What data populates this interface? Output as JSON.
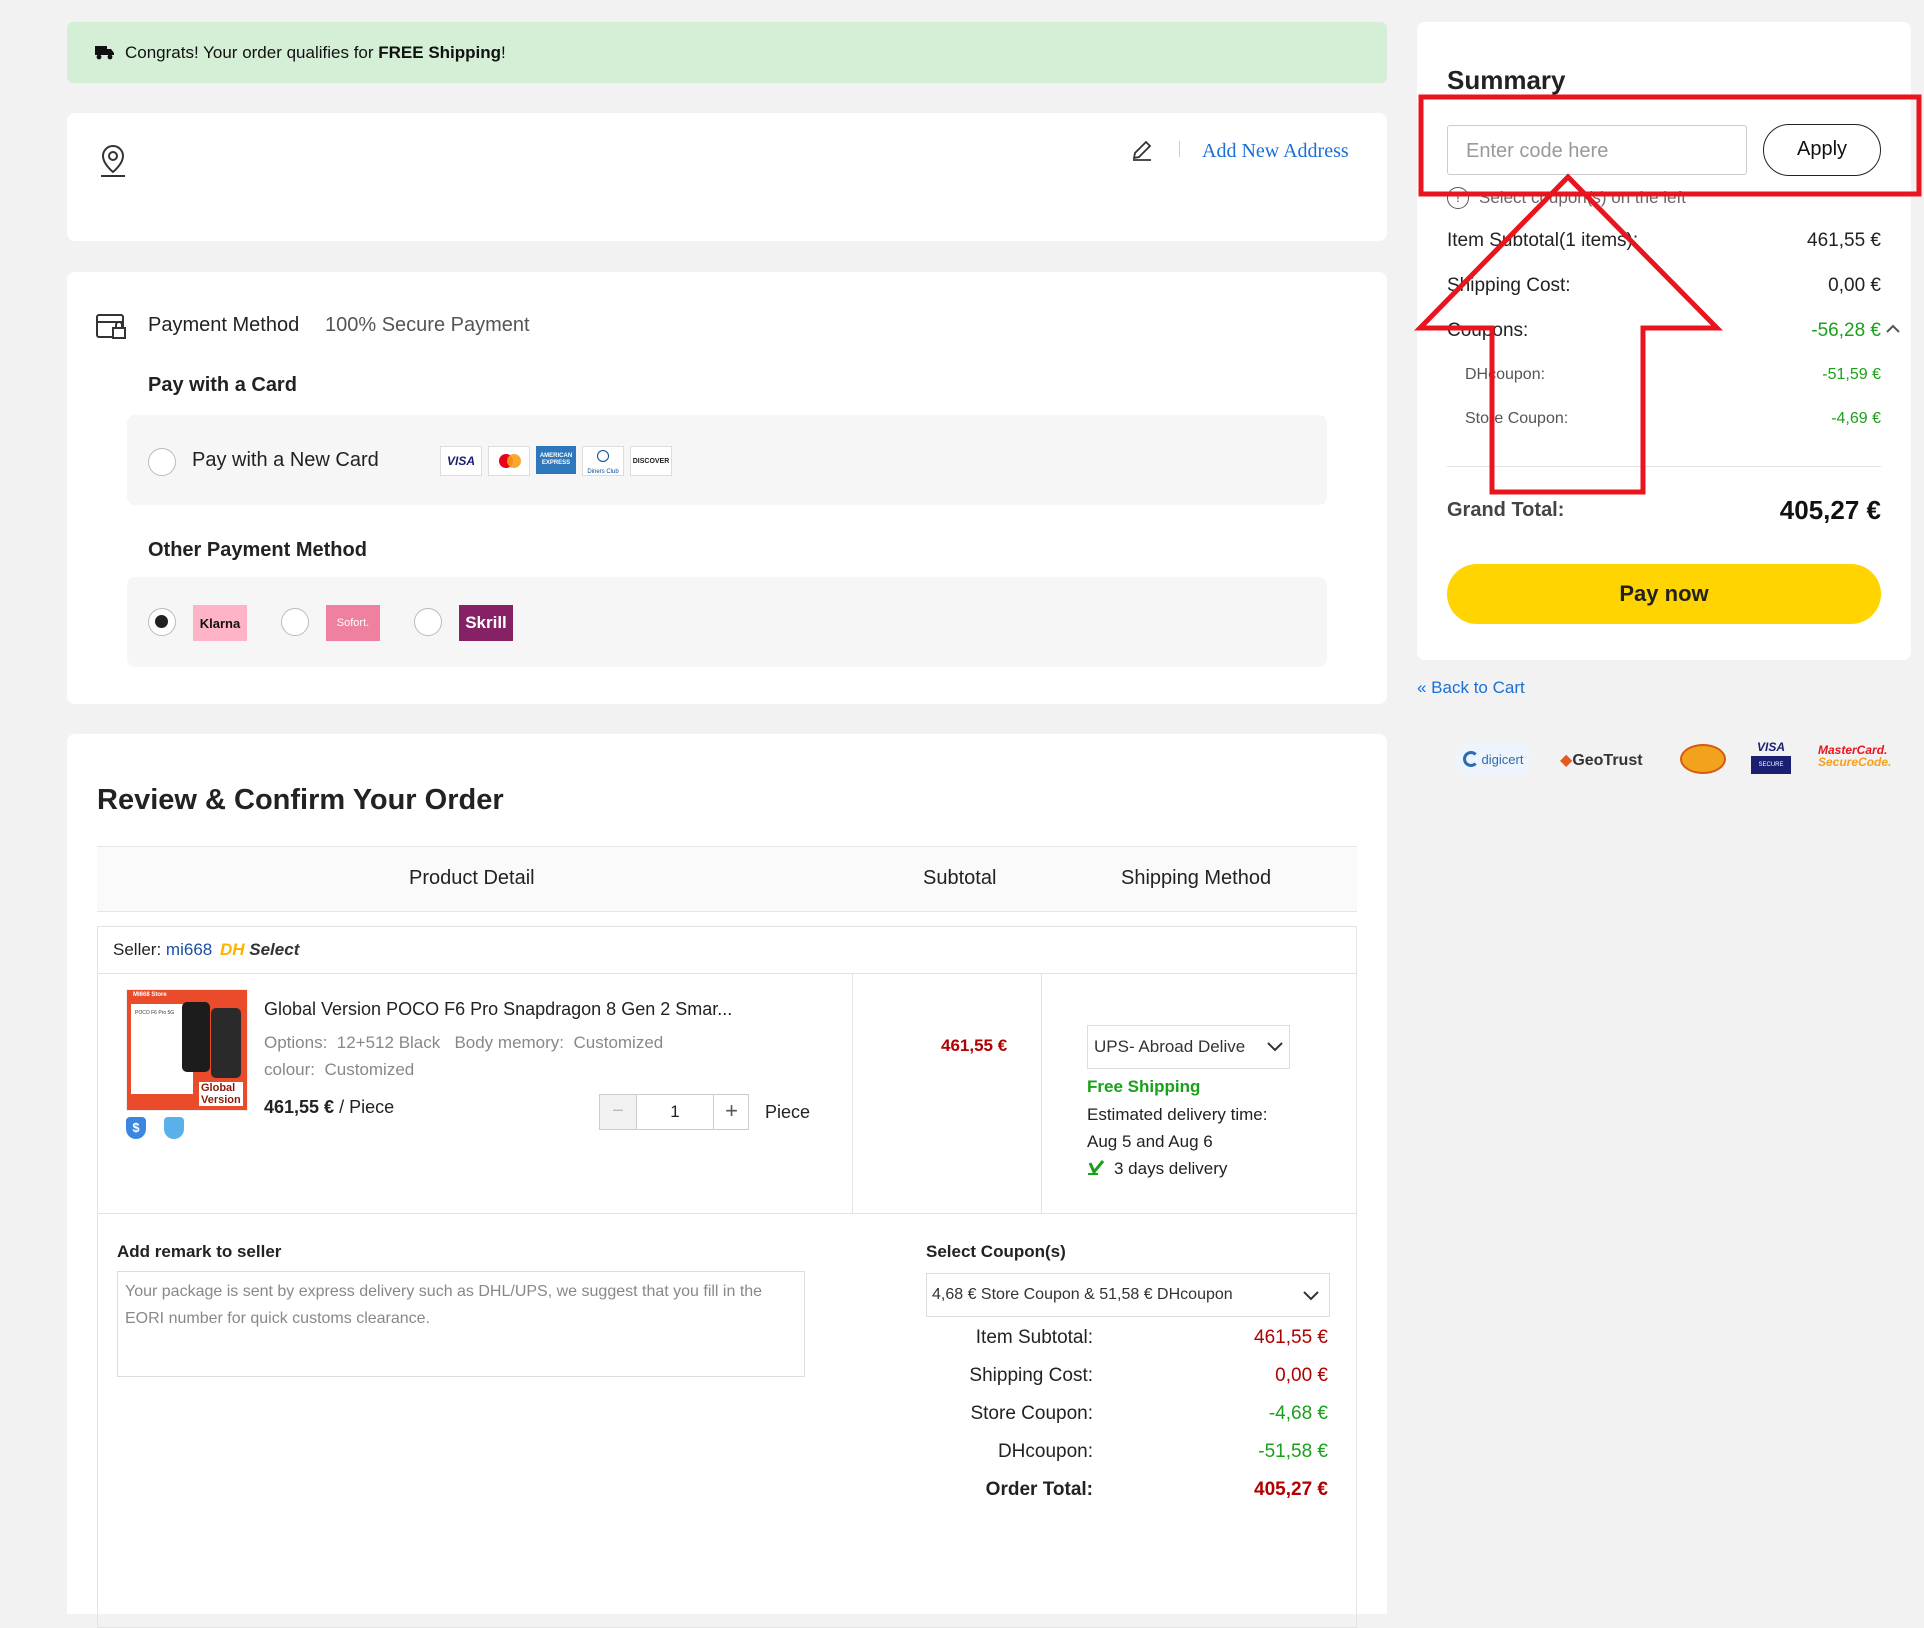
{
  "banner": {
    "prefix": "Congrats! Your order qualifies for ",
    "bold": "FREE Shipping",
    "suffix": "!"
  },
  "address": {
    "add_new": "Add New Address"
  },
  "payment": {
    "title": "Payment Method",
    "secure": "100% Secure Payment",
    "card_heading": "Pay with a Card",
    "new_card": "Pay with a New Card",
    "card_brands": [
      "VISA",
      "AMERICAN EXPRESS",
      "Diners Club",
      "DISCOVER"
    ],
    "other_heading": "Other Payment Method",
    "methods": [
      "Klarna",
      "Sofort.",
      "Skrill"
    ],
    "selected_method": "Klarna"
  },
  "review": {
    "title": "Review & Confirm Your Order",
    "headers": [
      "Product Detail",
      "Subtotal",
      "Shipping Method"
    ],
    "seller_label": "Seller: ",
    "seller_name": "mi668",
    "seller_badge_dh": "DH",
    "seller_badge_select": "Select",
    "thumb": {
      "store": "MI668 Store",
      "model": "POCO F6 Pro 5G",
      "line1": "Global",
      "line2": "Version"
    },
    "product": {
      "name": "Global Version POCO F6 Pro Snapdragon 8 Gen 2 Smar...",
      "options_label": "Options:",
      "options_value": "12+512 Black",
      "memory_label": "Body memory:",
      "memory_value": "Customized",
      "colour_label": "colour:",
      "colour_value": "Customized",
      "price": "461,55 €",
      "unit": " / Piece",
      "quantity": "1",
      "qty_unit": "Piece",
      "subtotal": "461,55 €"
    },
    "shipping": {
      "method": "UPS- Abroad Delive",
      "free": "Free Shipping",
      "est_label": "Estimated delivery time:",
      "est_dates": "Aug 5 and Aug 6",
      "days": "3 days delivery"
    },
    "remark_label": "Add remark to seller",
    "remark_placeholder": "Your package is sent by express delivery such as DHL/UPS, we suggest that you fill in the EORI number for quick customs clearance.",
    "coupon_label": "Select Coupon(s)",
    "coupon_value": "4,68 € Store Coupon & 51,58 € DHcoupon",
    "totals": [
      {
        "label": "Item Subtotal:",
        "value": "461,55 €"
      },
      {
        "label": "Shipping Cost:",
        "value": "0,00 €"
      },
      {
        "label": "Store Coupon:",
        "value": "-4,68 €"
      },
      {
        "label": "DHcoupon:",
        "value": "-51,58 €"
      },
      {
        "label": "Order Total:",
        "value": "405,27 €"
      }
    ]
  },
  "summary": {
    "title": "Summary",
    "code_placeholder": "Enter code here",
    "apply": "Apply",
    "select_note": "Select coupon(s) on the left",
    "item_subtotal_label": "Item Subtotal(1 items):",
    "item_subtotal": "461,55 €",
    "shipping_label": "Shipping Cost:",
    "shipping": "0,00 €",
    "coupons_label": "Coupons:",
    "coupons": "-56,28 €",
    "dhcoupon_label": "DHcoupon:",
    "dhcoupon": "-51,59 €",
    "store_coupon_label": "Store Coupon:",
    "store_coupon": "-4,69 €",
    "grand_label": "Grand Total:",
    "grand": "405,27 €",
    "pay": "Pay now",
    "back": "« Back to Cart"
  },
  "trust_badges": [
    "digicert",
    "GeoTrust",
    "VISA",
    "SECURE",
    "MasterCard.",
    "SecureCode."
  ],
  "colors": {
    "accent_blue": "#1a6fd6",
    "pay_yellow": "#ffd400",
    "green": "#1aa11a",
    "red": "#b00000",
    "annotation_red": "#e8141e",
    "banner_bg": "#d4efd6"
  }
}
